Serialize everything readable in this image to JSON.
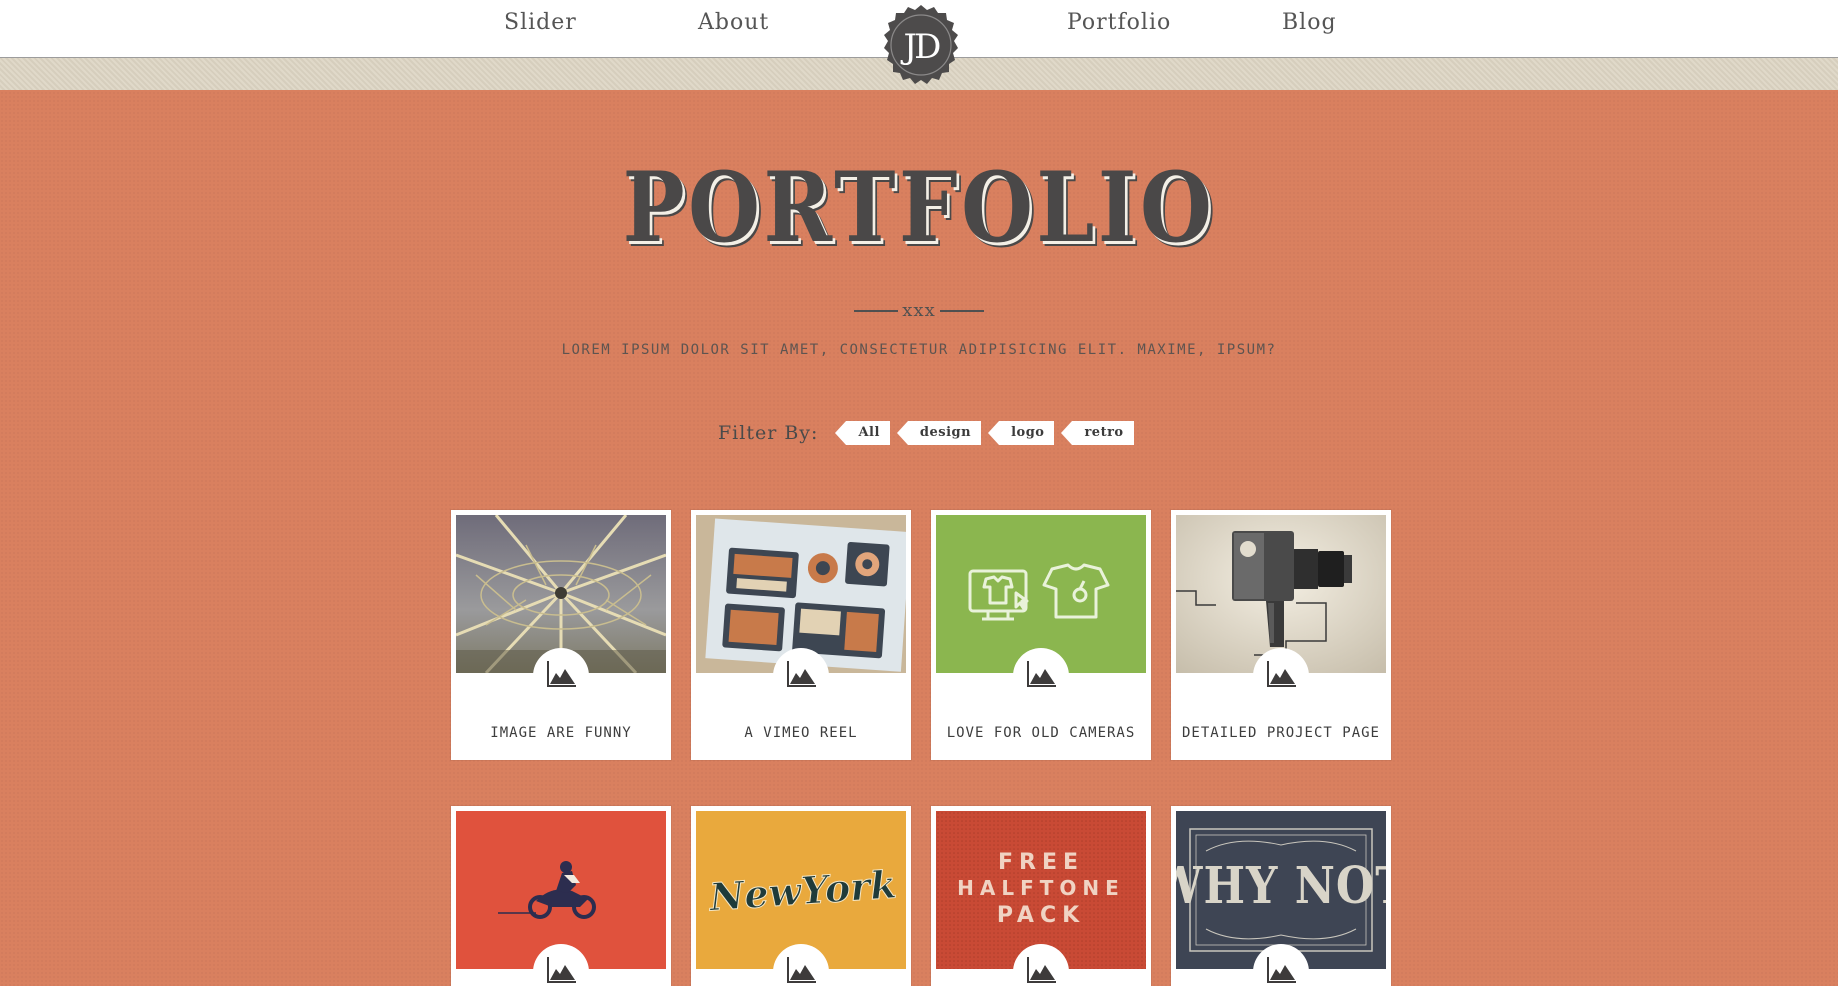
{
  "nav": {
    "links": [
      "Slider",
      "About",
      "Portfolio",
      "Blog"
    ],
    "logo_text": "JD"
  },
  "portfolio": {
    "title": "PORTFOLIO",
    "divider_text": "xxx",
    "subtitle": "LOREM IPSUM DOLOR SIT AMET, CONSECTETUR ADIPISICING ELIT. MAXIME, IPSUM?",
    "filter_label": "Filter By:",
    "filters": [
      "All",
      "design",
      "logo",
      "retro"
    ],
    "items": [
      {
        "caption": "IMAGE ARE FUNNY",
        "thumb": "ferris-wheel"
      },
      {
        "caption": "A VIMEO REEL",
        "thumb": "retro-electronics"
      },
      {
        "caption": "LOVE FOR OLD CAMERAS",
        "thumb": "green-icons"
      },
      {
        "caption": "DETAILED PROJECT PAGE",
        "thumb": "vintage-camera"
      },
      {
        "caption": "",
        "thumb": "motorcycle"
      },
      {
        "caption": "",
        "thumb": "new-york"
      },
      {
        "caption": "",
        "thumb": "halftone-pack"
      },
      {
        "caption": "",
        "thumb": "why-not"
      }
    ],
    "thumb_texts": {
      "new_york": "NewYork",
      "halftone": [
        "FREE",
        "HALFTONE",
        "PACK"
      ],
      "why_not": "WHY NOT"
    }
  },
  "colors": {
    "background": "#d9805f",
    "stripe": "#ddd5c3",
    "title": "#4a4848",
    "card": "#ffffff"
  }
}
